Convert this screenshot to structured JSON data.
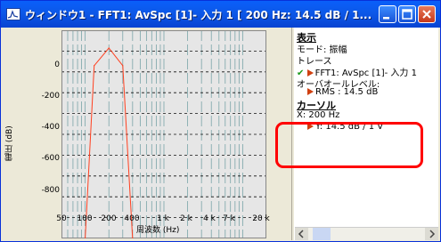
{
  "window": {
    "title": "ウィンドウ1 - FFT1: AvSpc [1]- 入力 1 [ 200 Hz:  14.5 dB / 1..."
  },
  "graph": {
    "ylabel": "電圧 (dB)",
    "xlabel": "周波数 (Hz)",
    "yticks": [
      "0",
      "-200",
      "-400",
      "-600",
      "-800"
    ],
    "xticks": [
      "50",
      "100",
      "200",
      "400",
      "1 k",
      "2 k",
      "4 k",
      "7 k",
      "20 k"
    ]
  },
  "chart_data": {
    "type": "line",
    "xlabel": "周波数 (Hz)",
    "ylabel": "電圧 (dB)",
    "xscale": "log",
    "xlim": [
      50,
      20000
    ],
    "ylim": [
      -900,
      100
    ],
    "grid": true,
    "series": [
      {
        "x": [
          100,
          130,
          200,
          300,
          400
        ],
        "y": [
          -900,
          -70,
          14.5,
          -70,
          -900
        ]
      }
    ]
  },
  "side": {
    "display_title": "表示",
    "mode": "モード: 振幅",
    "trace_title": "トレース",
    "trace_item": "FFT1: AvSpc [1]- 入力 1",
    "overall_level": "オーバオールレベル:",
    "rms": "RMS : 14.5 dB",
    "cursor_title": "カーソル",
    "cursor_x": "X: 200 Hz",
    "cursor_y": "Y: 14.5 dB / 1 V"
  },
  "colors": {
    "trace": "#ff4020",
    "highlight": "#ff0000",
    "titlebar": "#0a5ffa"
  }
}
